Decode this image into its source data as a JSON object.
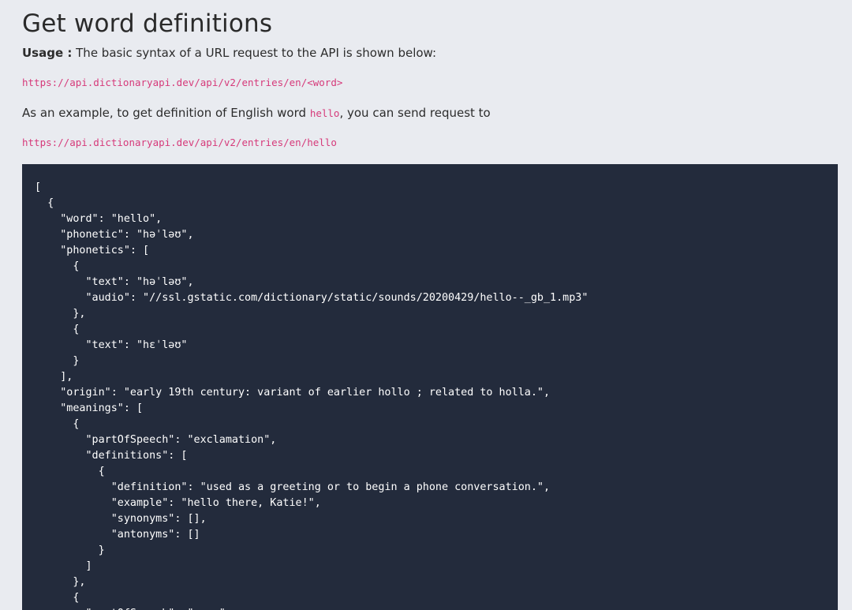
{
  "heading": "Get word definitions",
  "usage": {
    "label": "Usage :",
    "text": " The basic syntax of a URL request to the API is shown below:"
  },
  "syntax_url": "https://api.dictionaryapi.dev/api/v2/entries/en/<word>",
  "example": {
    "before": "As an example, to get definition of English word ",
    "word": "hello",
    "after": ", you can send request to"
  },
  "example_url": "https://api.dictionaryapi.dev/api/v2/entries/en/hello",
  "response_json": "[\n  {\n    \"word\": \"hello\",\n    \"phonetic\": \"həˈləʊ\",\n    \"phonetics\": [\n      {\n        \"text\": \"həˈləʊ\",\n        \"audio\": \"//ssl.gstatic.com/dictionary/static/sounds/20200429/hello--_gb_1.mp3\"\n      },\n      {\n        \"text\": \"hɛˈləʊ\"\n      }\n    ],\n    \"origin\": \"early 19th century: variant of earlier hollo ; related to holla.\",\n    \"meanings\": [\n      {\n        \"partOfSpeech\": \"exclamation\",\n        \"definitions\": [\n          {\n            \"definition\": \"used as a greeting or to begin a phone conversation.\",\n            \"example\": \"hello there, Katie!\",\n            \"synonyms\": [],\n            \"antonyms\": []\n          }\n        ]\n      },\n      {\n        \"partOfSpeech\": \"noun\","
}
